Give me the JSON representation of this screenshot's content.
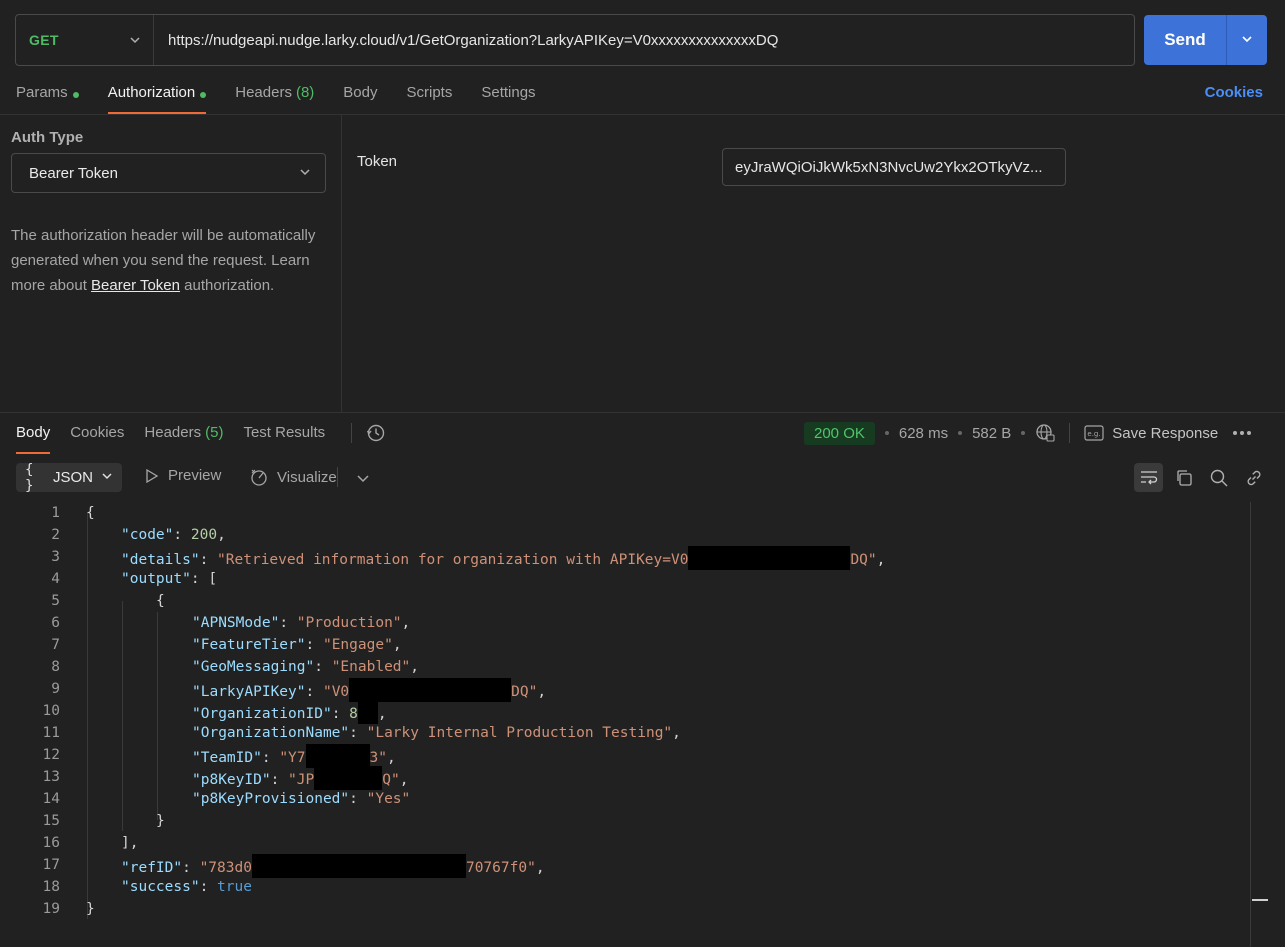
{
  "request": {
    "method": "GET",
    "url": "https://nudgeapi.nudge.larky.cloud/v1/GetOrganization?LarkyAPIKey=V0xxxxxxxxxxxxxxDQ",
    "send_label": "Send"
  },
  "request_tabs": {
    "params": "Params",
    "authorization": "Authorization",
    "headers": "Headers",
    "headers_count": "(8)",
    "body": "Body",
    "scripts": "Scripts",
    "settings": "Settings",
    "cookies": "Cookies"
  },
  "auth": {
    "type_label": "Auth Type",
    "type_value": "Bearer Token",
    "desc_before": "The authorization header will be automatically generated when you send the request. Learn more about ",
    "desc_link": "Bearer Token",
    "desc_after": " authorization.",
    "token_label": "Token",
    "token_value": "eyJraWQiOiJkWk5xN3NvcUw2Ykx2OTkyVz..."
  },
  "response_tabs": {
    "body": "Body",
    "cookies": "Cookies",
    "headers": "Headers",
    "headers_count": "(5)",
    "test_results": "Test Results"
  },
  "response_status": {
    "status": "200 OK",
    "time": "628 ms",
    "size": "582 B",
    "save_response": "Save Response"
  },
  "body_toolbar": {
    "format": "JSON",
    "preview": "Preview",
    "visualize": "Visualize"
  },
  "colors": {
    "accent_orange": "#f06a37",
    "send_blue": "#3d73d8",
    "get_green": "#4fbb64",
    "link_blue": "#4b8ef5"
  },
  "code": {
    "line_numbers": [
      "1",
      "2",
      "3",
      "4",
      "5",
      "6",
      "7",
      "8",
      "9",
      "10",
      "11",
      "12",
      "13",
      "14",
      "15",
      "16",
      "17",
      "18",
      "19"
    ],
    "l1": "{",
    "l2_key": "\"code\"",
    "l2_val": "200",
    "l3_key": "\"details\"",
    "l3_val_a": "\"Retrieved information for organization with APIKey=V0",
    "l3_val_b": "DQ\"",
    "l4_key": "\"output\"",
    "l4_val": "[",
    "l5": "{",
    "l6_key": "\"APNSMode\"",
    "l6_val": "\"Production\"",
    "l7_key": "\"FeatureTier\"",
    "l7_val": "\"Engage\"",
    "l8_key": "\"GeoMessaging\"",
    "l8_val": "\"Enabled\"",
    "l9_key": "\"LarkyAPIKey\"",
    "l9_val_a": "\"V0",
    "l9_val_b": "DQ\"",
    "l10_key": "\"OrganizationID\"",
    "l10_val_a": "8",
    "l11_key": "\"OrganizationName\"",
    "l11_val": "\"Larky Internal Production Testing\"",
    "l12_key": "\"TeamID\"",
    "l12_val_a": "\"Y7",
    "l12_val_b": "3\"",
    "l13_key": "\"p8KeyID\"",
    "l13_val_a": "\"JP",
    "l13_val_b": "Q\"",
    "l14_key": "\"p8KeyProvisioned\"",
    "l14_val": "\"Yes\"",
    "l15": "}",
    "l16": "],",
    "l17_key": "\"refID\"",
    "l17_val_a": "\"783d0",
    "l17_val_b": "70767f0\"",
    "l18_key": "\"success\"",
    "l18_val": "true",
    "l19": "}"
  }
}
